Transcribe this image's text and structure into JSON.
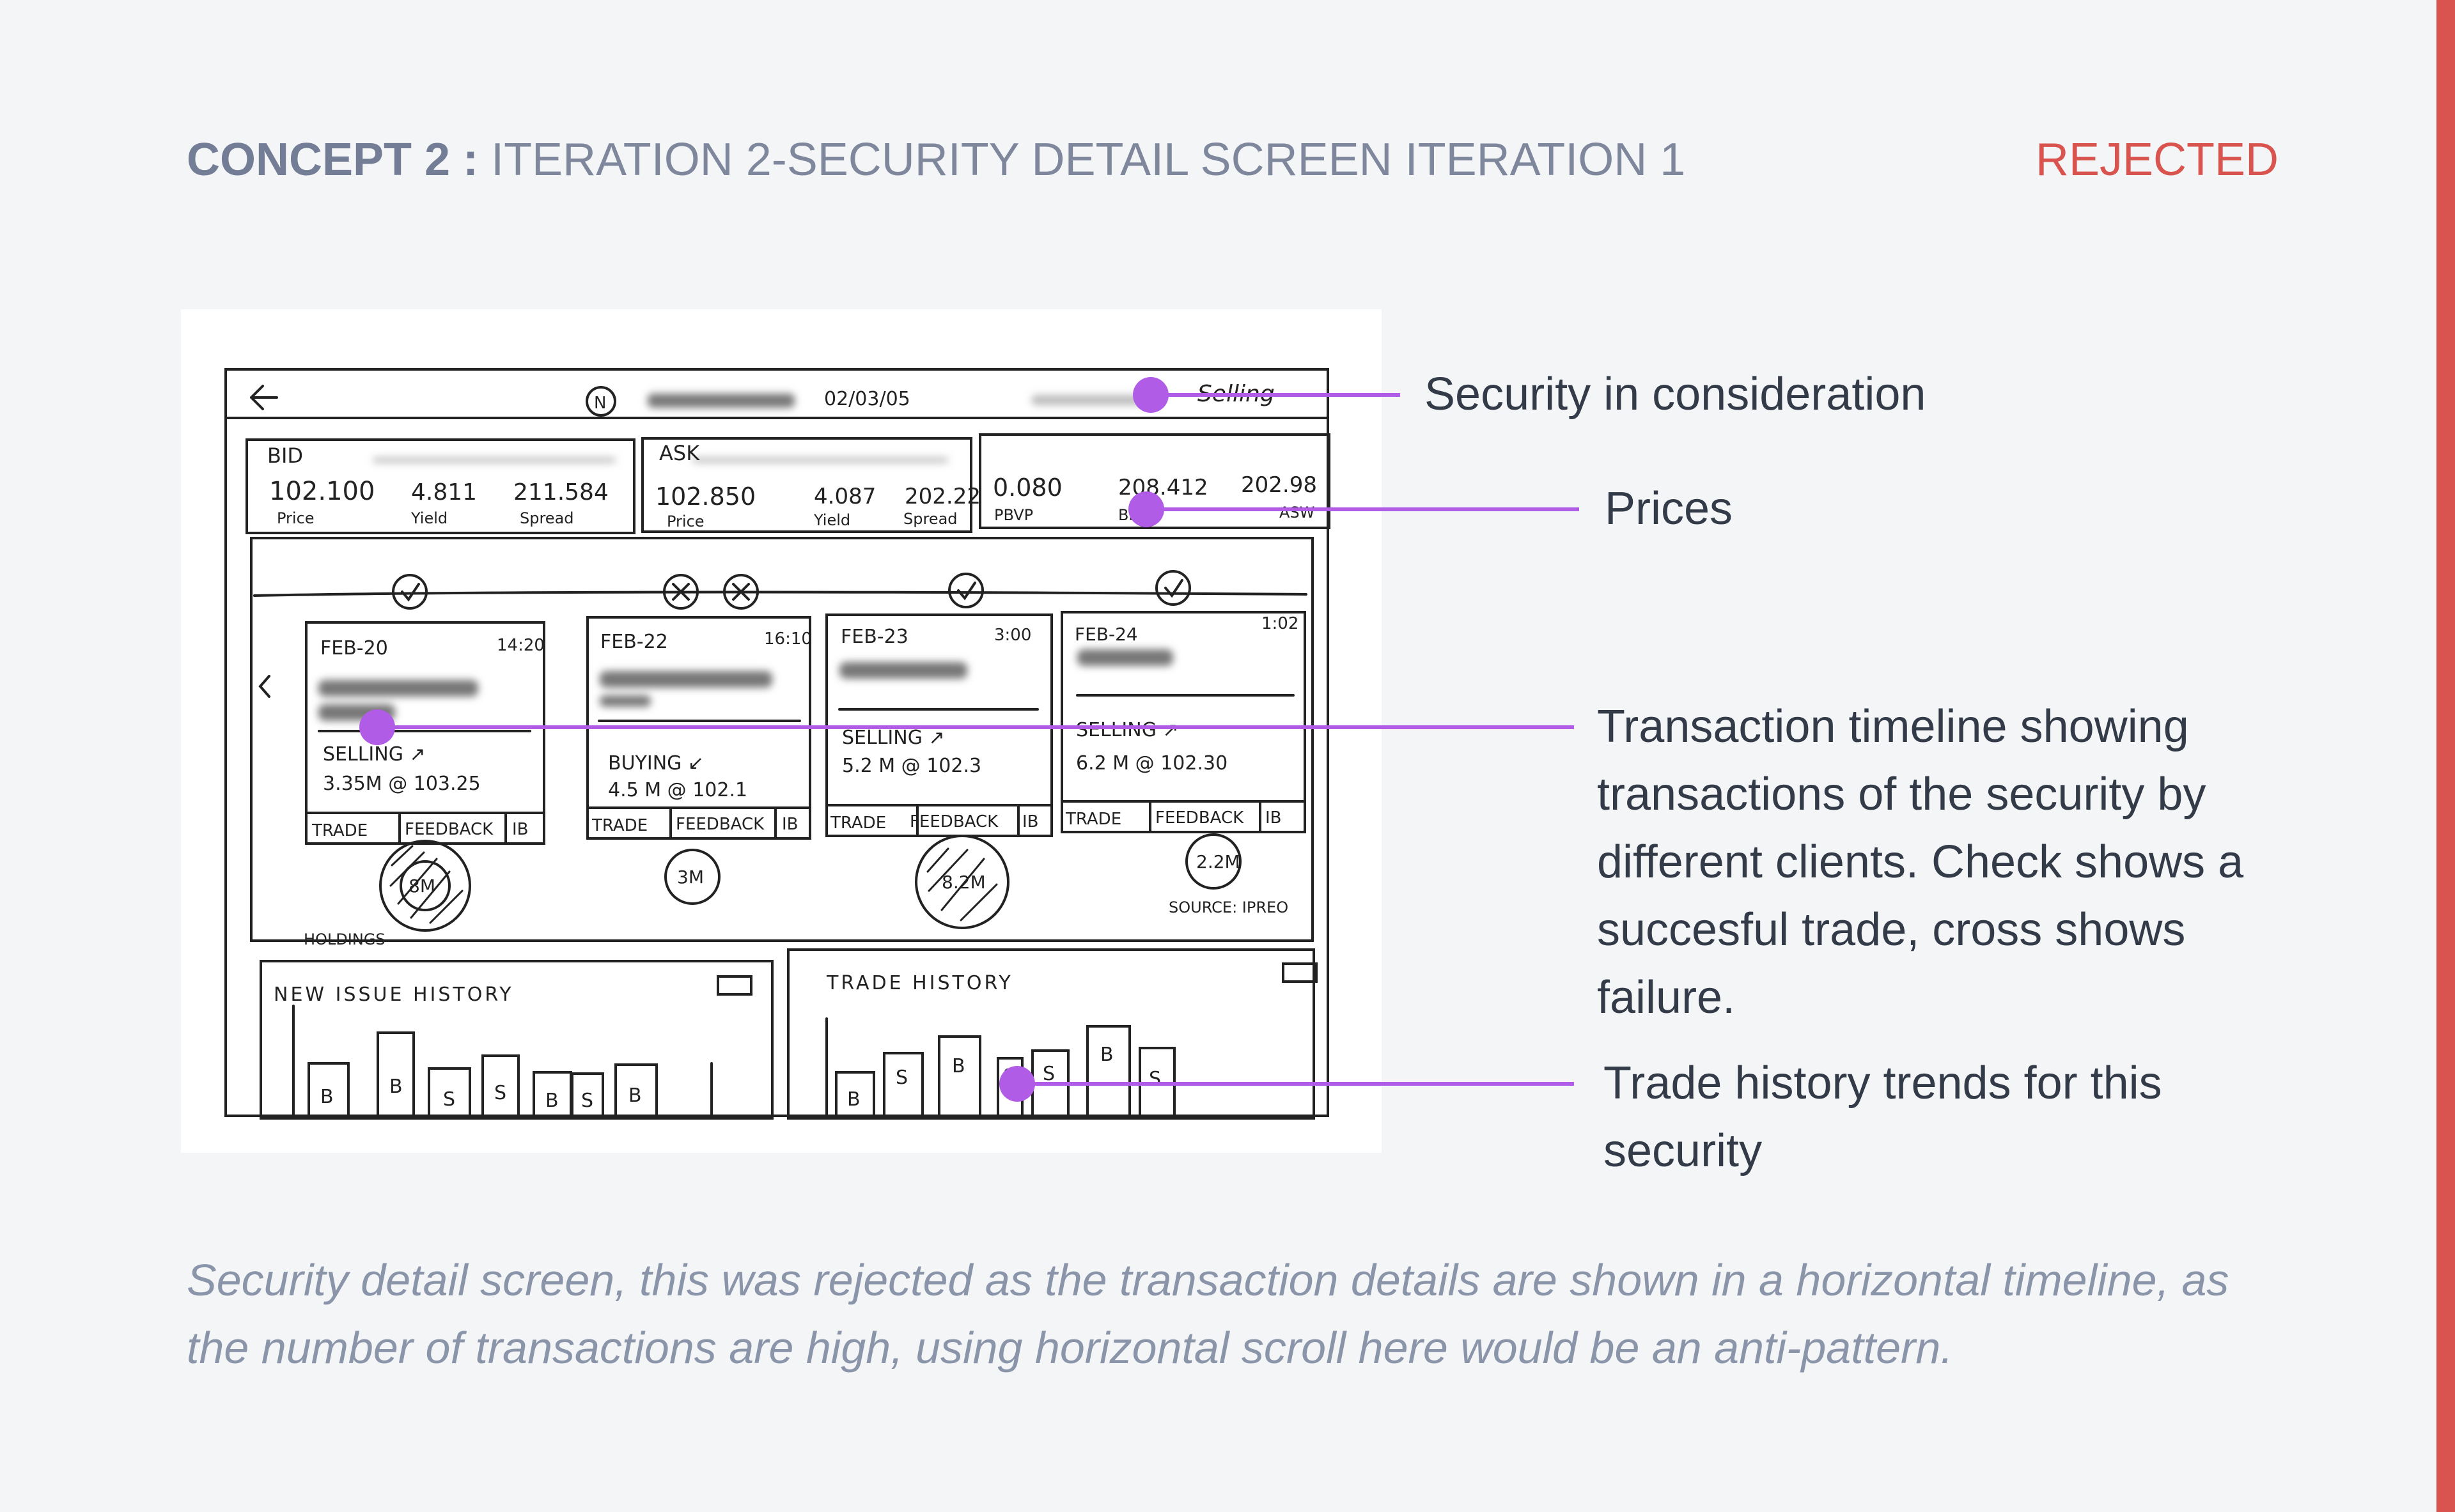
{
  "header": {
    "concept_label": "CONCEPT 2 :",
    "iteration_title": "ITERATION 2-SECURITY DETAIL SCREEN ITERATION 1",
    "status": "REJECTED"
  },
  "colors": {
    "background": "#f4f5f7",
    "title": "#7e879c",
    "rejected": "#d9534f",
    "callout_line": "#b05ce6",
    "caption": "#8b95aa"
  },
  "sketch": {
    "top_bar": {
      "badge": "N",
      "date": "02/03/05",
      "status_word": "Selling"
    },
    "price_boxes": [
      {
        "label": "BID",
        "values": [
          "102.100",
          "4.811",
          "211.584"
        ],
        "sublabels": [
          "Price",
          "Yield",
          "Spread"
        ]
      },
      {
        "label": "ASK",
        "values": [
          "102.850",
          "4.087",
          "202.22"
        ],
        "sublabels": [
          "Price",
          "Yield",
          "Spread"
        ]
      },
      {
        "label": "",
        "values": [
          "0.080",
          "208.412",
          "202.98"
        ],
        "sublabels": [
          "PBVP",
          "Bid",
          "ASW"
        ]
      }
    ],
    "transactions": [
      {
        "date": "FEB-20",
        "time": "14:20",
        "action": "SELLING ↗",
        "detail": "3.35M @ 103.25",
        "bubble": "8M"
      },
      {
        "date": "FEB-22",
        "time": "16:10",
        "action": "BUYING ↙",
        "detail": "4.5 M @ 102.1",
        "bubble": "3M"
      },
      {
        "date": "FEB-23",
        "time": "3:00",
        "action": "SELLING ↗",
        "detail": "5.2 M @ 102.3",
        "bubble": "8.2M"
      },
      {
        "date": "FEB-24",
        "time": "1:02",
        "action": "SELLING ↗",
        "detail": "6.2 M @ 102.30",
        "bubble": "2.2M"
      }
    ],
    "card_buttons": [
      "TRADE",
      "FEEDBACK",
      "IB"
    ],
    "holdings_label": "HOLDINGS",
    "source_label": "SOURCE: IPREO",
    "new_issue_history": {
      "title": "NEW ISSUE HISTORY",
      "bars": [
        "B",
        "B",
        "S",
        "S",
        "B",
        "S",
        "B"
      ]
    },
    "trade_history": {
      "title": "TRADE HISTORY",
      "bars": [
        "B",
        "S",
        "B",
        "S",
        "S",
        "B",
        "S"
      ]
    }
  },
  "callouts": {
    "security": "Security in consideration",
    "prices": "Prices",
    "timeline": "Transaction timeline showing transactions of the security by different clients. Check shows a succesful trade, cross shows failure.",
    "trade_history": "Trade history trends for this security"
  },
  "caption": "Security detail screen, this was rejected as the transaction details are shown in a horizontal timeline, as the number of transactions are high, using horizontal scroll here would be an anti-pattern."
}
